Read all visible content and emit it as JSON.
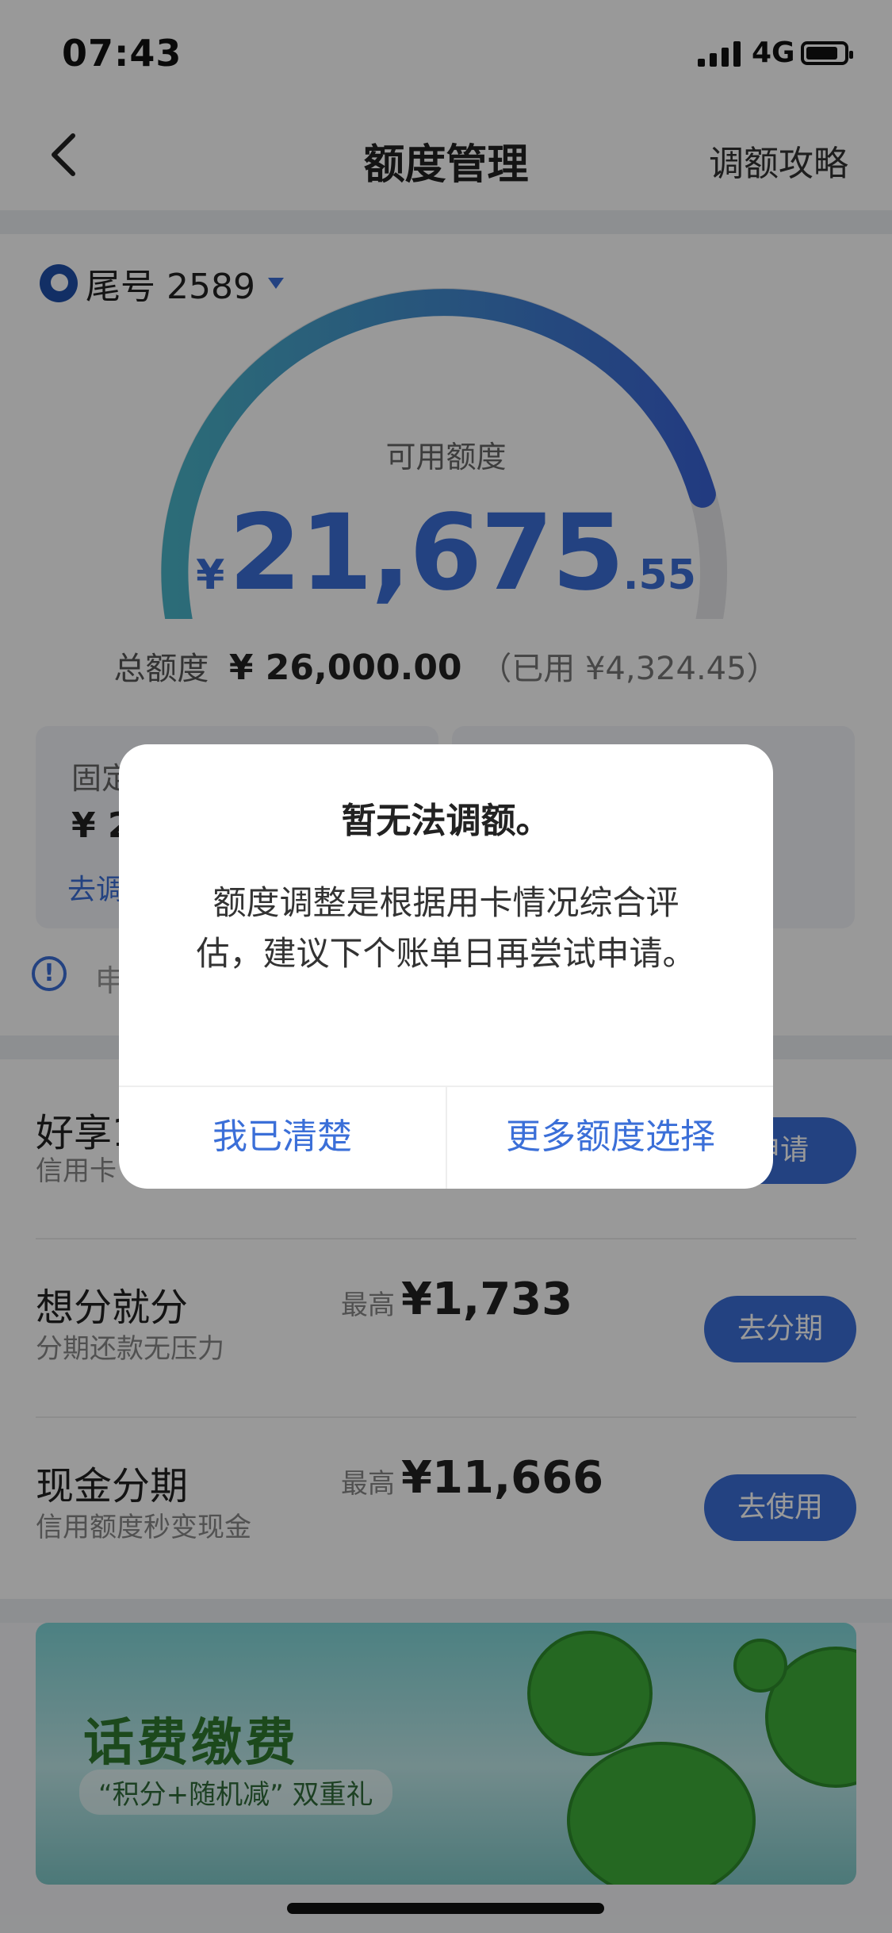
{
  "status": {
    "time": "07:43",
    "network": "4G"
  },
  "nav": {
    "title": "额度管理",
    "right_label": "调额攻略"
  },
  "card": {
    "tail_label": "尾号 2589"
  },
  "credit": {
    "available_label": "可用额度",
    "currency": "¥",
    "available_int": "21,675",
    "available_dec": ".55",
    "available_ratio": 0.8337,
    "total_label": "总额度",
    "total_value": "¥ 26,000.00",
    "used_text": "（已用 ¥4,324.45）"
  },
  "subcards": {
    "fixed_title": "固定",
    "fixed_amount": "¥ 2",
    "adjust_link": "去调"
  },
  "info": {
    "text": "申"
  },
  "rows": [
    {
      "title": "好享1",
      "subtitle": "信用卡",
      "max_label": "",
      "max_value": "",
      "button": "申请"
    },
    {
      "title": "想分就分",
      "subtitle": "分期还款无压力",
      "max_label": "最高",
      "max_value": "¥1,733",
      "button": "去分期"
    },
    {
      "title": "现金分期",
      "subtitle": "信用额度秒变现金",
      "max_label": "最高",
      "max_value": "¥11,666",
      "button": "去使用"
    }
  ],
  "banner": {
    "title": "话费缴费",
    "subtitle": "“积分+随机减” 双重礼"
  },
  "modal": {
    "title": "暂无法调额。",
    "body": "额度调整是根据用卡情况综合评估，建议下个账单日再尝试申请。",
    "button_left": "我已清楚",
    "button_right": "更多额度选择"
  },
  "colors": {
    "accent": "#3b6fd8",
    "gauge_start": "#4ab4c8",
    "gauge_end": "#3a63d6"
  }
}
